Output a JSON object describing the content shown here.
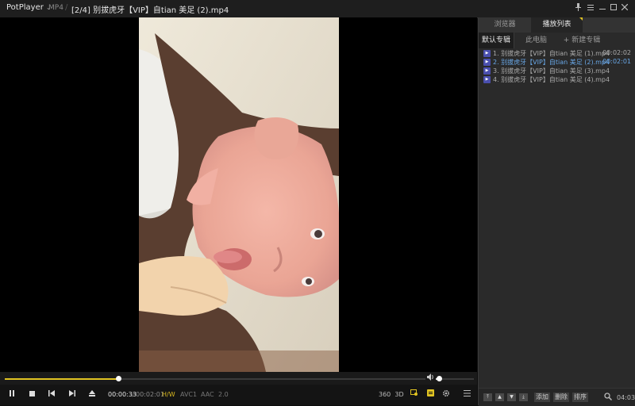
{
  "titlebar": {
    "app_name": "PotPlayer",
    "chevron": "⌄",
    "format": "MP4",
    "separator": "/",
    "title": "[2/4] 别拔虎牙【VIP】自tian 美足 (2).mp4",
    "window_controls": [
      "pin-icon",
      "menu-icon",
      "minimize-icon",
      "maximize-icon",
      "fullscreen-icon",
      "close-icon"
    ]
  },
  "seek": {
    "progress": 0.27,
    "volume": 0.08
  },
  "controls": {
    "time_current": "00:00:33",
    "time_separator": "/",
    "time_total": "00:02:01",
    "tags": [
      "H/W",
      "AVC1",
      "AAC",
      "2.0"
    ],
    "right_icons": [
      "360",
      "3D"
    ]
  },
  "panel": {
    "tabs": [
      "浏览器",
      "播放列表"
    ],
    "subtabs": [
      "默认专辑",
      "此电脑",
      "+ 新建专辑"
    ],
    "playlist": [
      {
        "name": "1. 别拔虎牙【VIP】自tian 美足 (1).mp4",
        "duration": "00:02:02"
      },
      {
        "name": "2. 别拔虎牙【VIP】自tian 美足 (2).mp4",
        "duration": "00:02:01",
        "active": true
      },
      {
        "name": "3. 别拔虎牙【VIP】自tian 美足 (3).mp4",
        "duration": ""
      },
      {
        "name": "4. 别拔虎牙【VIP】自tian 美足 (4).mp4",
        "duration": ""
      }
    ],
    "bottom_buttons": [
      "添加",
      "删除",
      "排序"
    ],
    "total_time": "04:03"
  },
  "colors": {
    "accent": "#e0c322",
    "active_item": "#69a7e6"
  }
}
